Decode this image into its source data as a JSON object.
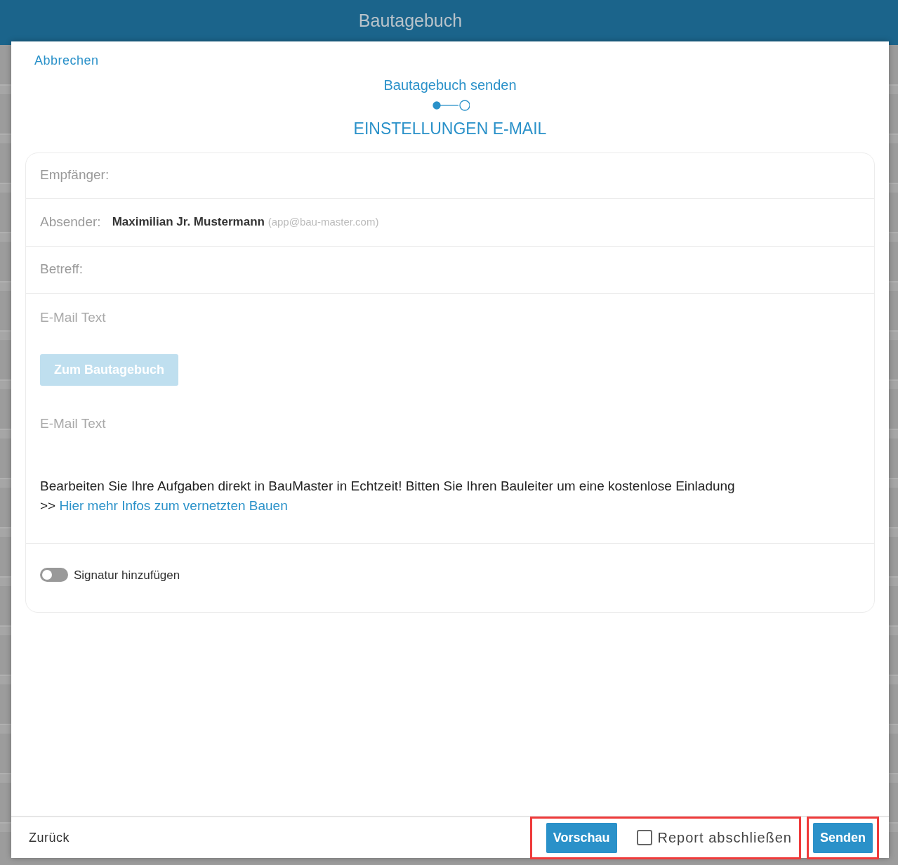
{
  "app_bar": {
    "title": "Bautagebuch"
  },
  "dialog": {
    "cancel": "Abbrechen",
    "heading": "Bautagebuch senden",
    "steps": [
      {
        "selected": true
      },
      {
        "selected": false
      }
    ],
    "section_title": "EINSTELLUNGEN E-MAIL",
    "form": {
      "recipient_label": "Empfänger:",
      "sender_label": "Absender:",
      "sender_name": "Maximilian Jr. Mustermann",
      "sender_email": "(app@bau-master.com)",
      "subject_label": "Betreff:",
      "email_text": {
        "placeholder": "E-Mail Text"
      },
      "diary_button": {
        "label": "Zum Bautagebuch",
        "disabled": true
      },
      "email_text_2": {
        "placeholder": "E-Mail Text"
      },
      "promo_text": "Bearbeiten Sie Ihre Aufgaben direkt in BauMaster in Echtzeit! Bitten Sie Ihren Bauleiter um eine kostenlose Einladung",
      "promo_prefix": ">>",
      "promo_link": "Hier mehr Infos zum vernetzten Bauen",
      "signature": {
        "label": "Signatur hinzufügen",
        "on": false
      }
    },
    "footer": {
      "back": "Zurück",
      "preview": "Vorschau",
      "close_report": {
        "label": "Report abschließen",
        "checked": false
      },
      "send": "Senden"
    }
  }
}
